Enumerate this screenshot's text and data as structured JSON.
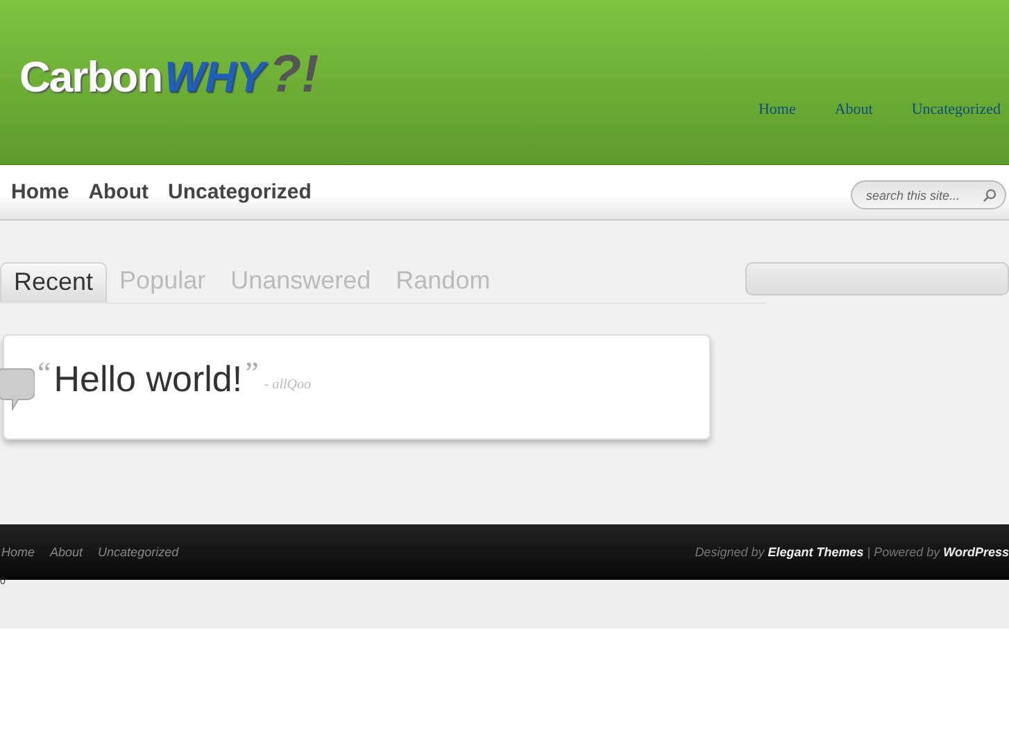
{
  "header": {
    "logo": {
      "word": "Carbon",
      "accent": "WHY",
      "marks": "?!"
    },
    "top_links": [
      "Home",
      "About",
      "Uncategorized"
    ]
  },
  "nav": {
    "items": [
      "Home",
      "About",
      "Uncategorized"
    ],
    "search": {
      "placeholder": "search this site..."
    }
  },
  "tabs": [
    {
      "label": "Recent",
      "selected": true
    },
    {
      "label": "Popular",
      "selected": false
    },
    {
      "label": "Unanswered",
      "selected": false
    },
    {
      "label": "Random",
      "selected": false
    }
  ],
  "post": {
    "open_quote": "“",
    "title": "Hello world!",
    "close_quote": "”",
    "author": "- allQoo"
  },
  "footer": {
    "links": [
      "Home",
      "About",
      "Uncategorized"
    ],
    "credit": "Designed by **Elegant Themes** | Powered by **WordPress**"
  },
  "footnote": "0"
}
